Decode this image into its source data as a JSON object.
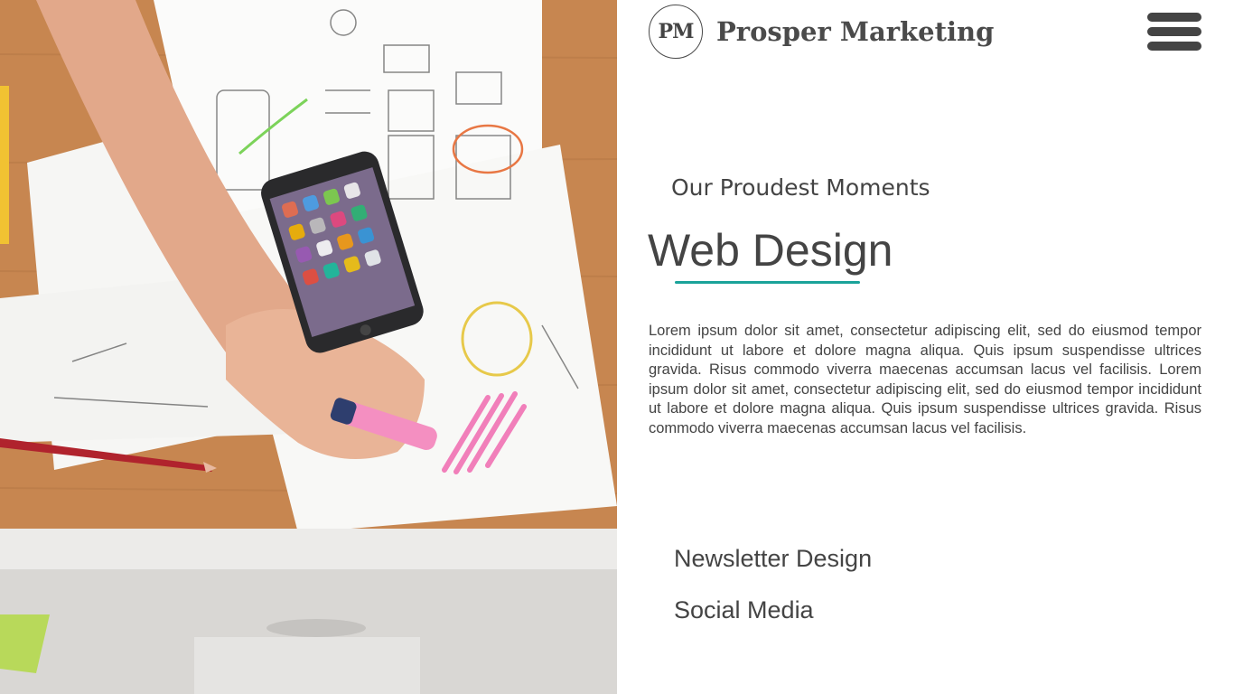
{
  "brand": {
    "logo_initials": "PM",
    "name": "Prosper Marketing"
  },
  "header": {
    "menu_icon": "hamburger-menu-icon"
  },
  "hero": {
    "subtitle": "Our Proudest Moments",
    "title": "Web Design",
    "accent_color": "#1aa39a",
    "body": "Lorem ipsum dolor sit amet, consectetur adipiscing elit, sed do eiusmod tempor incididunt ut labore et dolore magna aliqua. Quis ipsum suspendisse ultrices gravida. Risus commodo viverra maecenas accumsan lacus vel facilisis. Lorem ipsum dolor sit amet, consectetur adipiscing elit, sed do eiusmod tempor incididunt ut labore et dolore magna aliqua. Quis ipsum suspendisse ultrices gravida. Risus commodo viverra maecenas accumsan lacus vel facilisis."
  },
  "nav": {
    "items": [
      {
        "label": "Newsletter Design"
      },
      {
        "label": "Social Media"
      }
    ]
  },
  "colors": {
    "text": "#444444",
    "background": "#ffffff",
    "desk": "#c9874f"
  }
}
